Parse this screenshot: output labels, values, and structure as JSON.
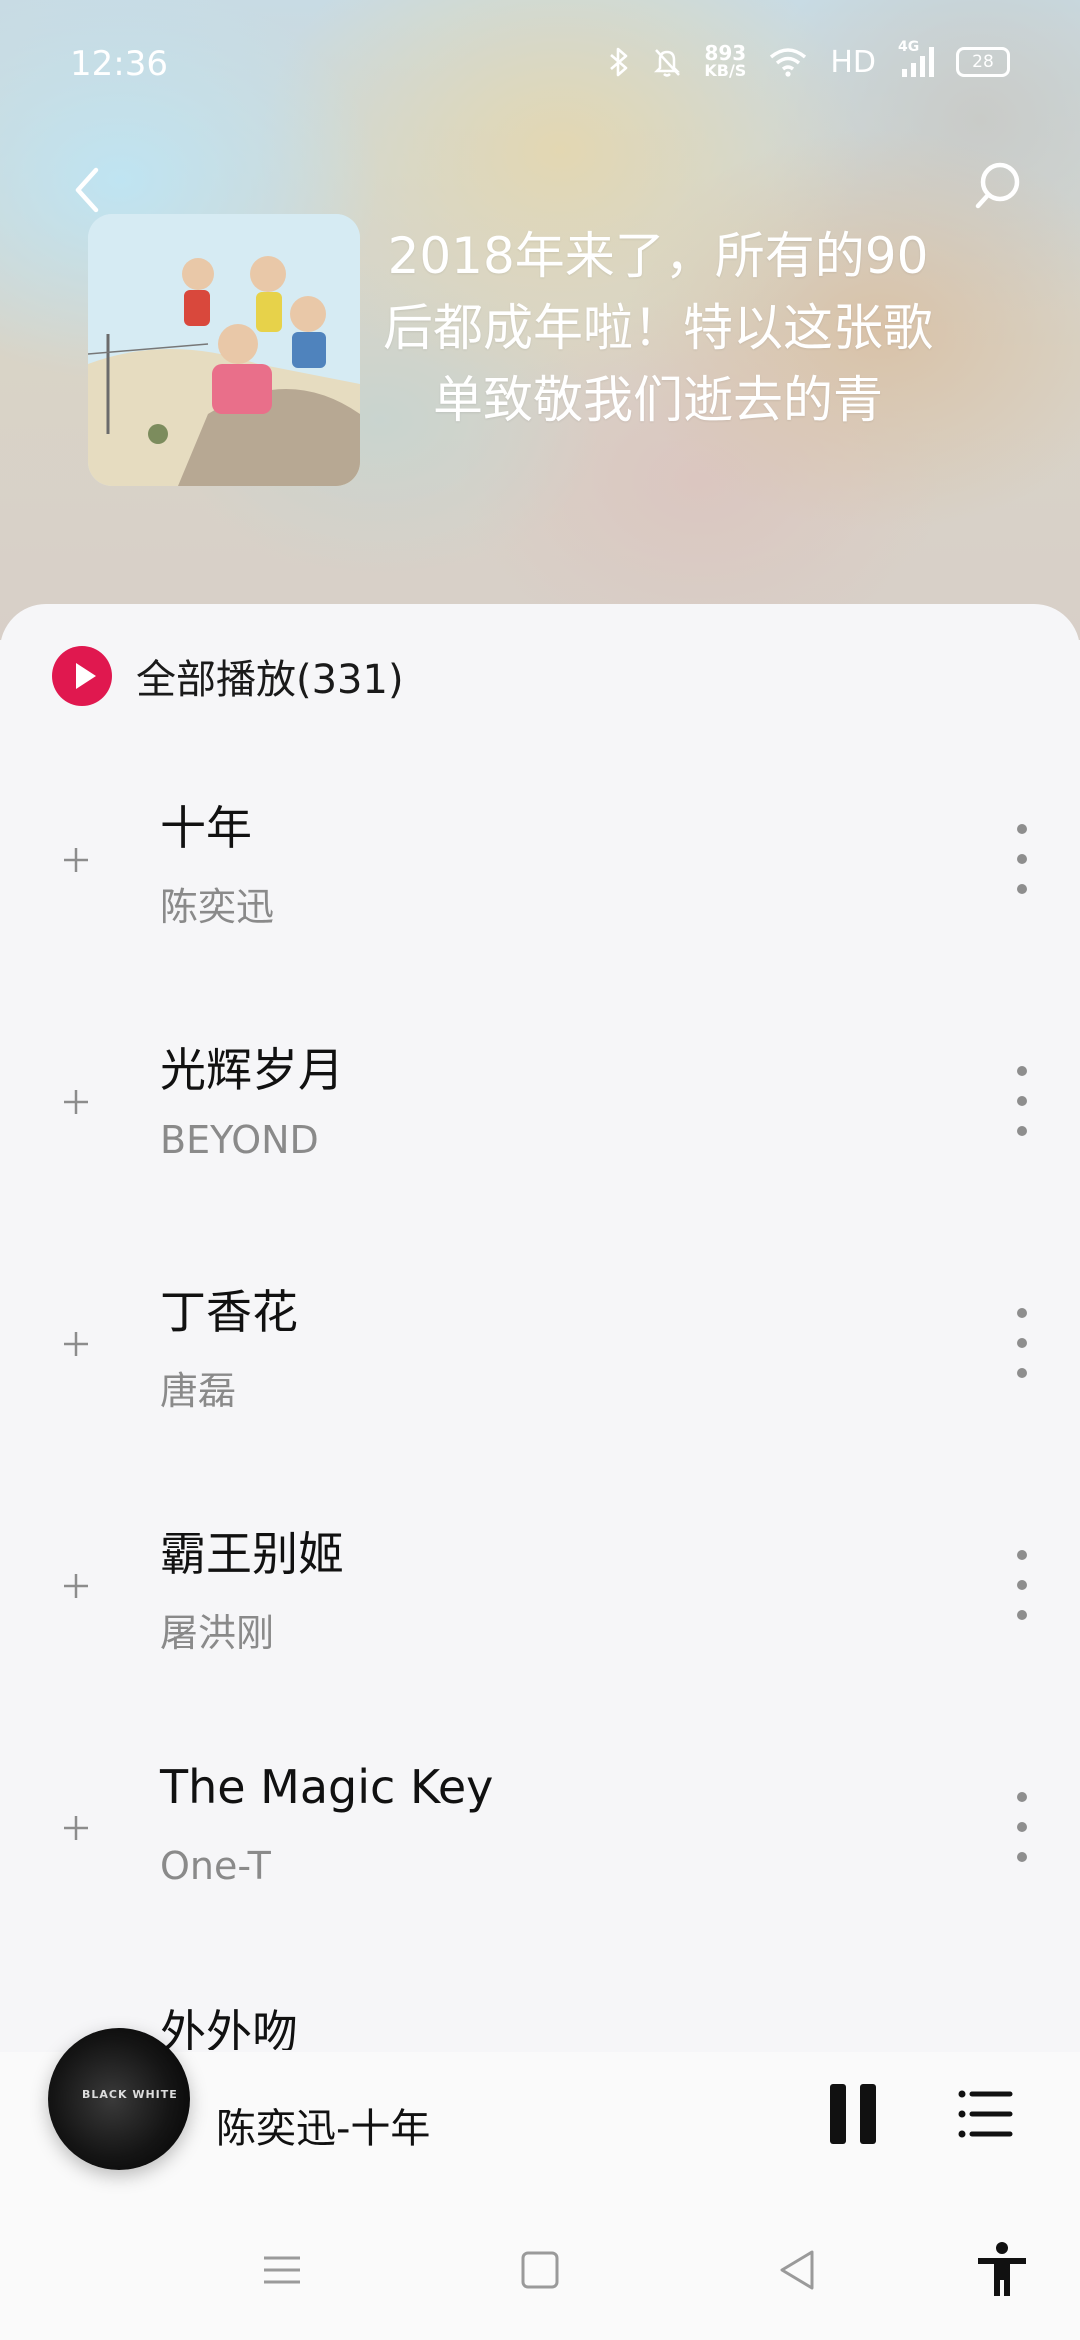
{
  "status_bar": {
    "time": "12:36",
    "net_speed_value": "893",
    "net_speed_unit": "KB/S",
    "hd_label": "HD",
    "network_type": "4G",
    "battery": "28"
  },
  "header": {
    "playlist_title": "2018年来了，所有的90后都成年啦！特以这张歌单致敬我们逝去的青"
  },
  "play_all": {
    "label": "全部播放(331)"
  },
  "songs": [
    {
      "title": "十年",
      "artist": "陈奕迅"
    },
    {
      "title": "光辉岁月",
      "artist": "BEYOND"
    },
    {
      "title": "丁香花",
      "artist": "唐磊"
    },
    {
      "title": "霸王别姬",
      "artist": "屠洪刚"
    },
    {
      "title": "The Magic Key",
      "artist": "One-T"
    }
  ],
  "partial_song": {
    "title": "外外吻"
  },
  "mini_player": {
    "now_playing": "陈奕迅-十年",
    "cover_text": "BLACK WHITE"
  },
  "colors": {
    "accent": "#e0184f"
  }
}
